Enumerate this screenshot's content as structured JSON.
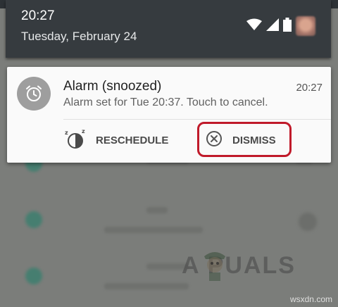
{
  "status_bar": {
    "time": "20:27",
    "date": "Tuesday, February 24",
    "icons": [
      "wifi-icon",
      "signal-icon",
      "battery-icon",
      "avatar"
    ]
  },
  "notification": {
    "icon": "alarm-clock-icon",
    "title": "Alarm (snoozed)",
    "time": "20:27",
    "text": "Alarm set for Tue 20:37. Touch to cancel.",
    "actions": {
      "reschedule": {
        "label": "RESCHEDULE",
        "icon": "snooze-clock-icon"
      },
      "dismiss": {
        "label": "DISMISS",
        "icon": "dismiss-circle-x-icon"
      }
    }
  },
  "overlay": {
    "highlight_color": "#c01a2a",
    "watermark": "A  PUALS",
    "site": "wsxdn.com"
  },
  "colors": {
    "header_bg": "#363b3f",
    "card_bg": "#fafafa",
    "background": "#7b7d7a"
  }
}
